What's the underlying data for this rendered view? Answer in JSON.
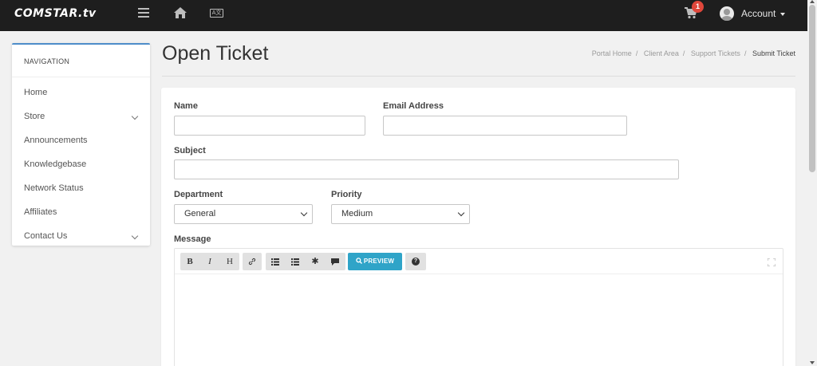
{
  "header": {
    "logo": "COMSTAR.tv",
    "cart_count": "1",
    "account_label": "Account",
    "icons": [
      "menu-icon",
      "home-icon",
      "language-icon",
      "cart-icon",
      "avatar-icon"
    ]
  },
  "sidebar": {
    "title": "NAVIGATION",
    "items": [
      {
        "label": "Home",
        "has_submenu": false
      },
      {
        "label": "Store",
        "has_submenu": true
      },
      {
        "label": "Announcements",
        "has_submenu": false
      },
      {
        "label": "Knowledgebase",
        "has_submenu": false
      },
      {
        "label": "Network Status",
        "has_submenu": false
      },
      {
        "label": "Affiliates",
        "has_submenu": false
      },
      {
        "label": "Contact Us",
        "has_submenu": true
      }
    ]
  },
  "page": {
    "title": "Open Ticket",
    "breadcrumb": [
      "Portal Home",
      "Client Area",
      "Support Tickets",
      "Submit Ticket"
    ]
  },
  "form": {
    "name_label": "Name",
    "name_value": "",
    "email_label": "Email Address",
    "email_value": "",
    "subject_label": "Subject",
    "subject_value": "",
    "department_label": "Department",
    "department_value": "General",
    "priority_label": "Priority",
    "priority_value": "Medium",
    "message_label": "Message"
  },
  "editor": {
    "bold": "B",
    "italic": "I",
    "heading": "H",
    "preview_label": "PREVIEW",
    "help": "?"
  },
  "colors": {
    "topbar": "#1e1e1e",
    "accent": "#2fa4c8",
    "sidebar_border": "#4e8dc9",
    "badge": "#e0473b"
  }
}
